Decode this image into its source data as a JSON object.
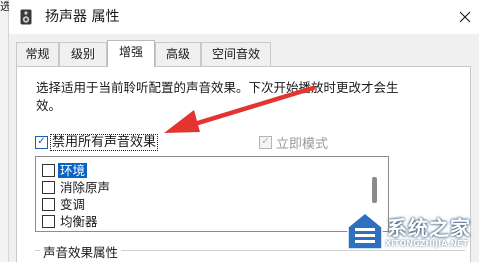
{
  "window": {
    "title": "扬声器 属性",
    "left_edge_text": "选"
  },
  "tabs": [
    {
      "label": "常规"
    },
    {
      "label": "级别"
    },
    {
      "label": "增强",
      "active": true
    },
    {
      "label": "高级"
    },
    {
      "label": "空间音效"
    }
  ],
  "enhancements": {
    "description_line1": "选择适用于当前聆听配置的声音效果。下次开始播放时更改才会生",
    "description_line2": "效。",
    "disable_all": {
      "label": "禁用所有声音效果",
      "checked": true
    },
    "immediate_mode": {
      "label": "立即模式",
      "checked": true,
      "enabled": false
    },
    "effects": [
      {
        "label": "环境",
        "checked": false,
        "selected": true
      },
      {
        "label": "消除原声",
        "checked": false
      },
      {
        "label": "变调",
        "checked": false
      },
      {
        "label": "均衡器",
        "checked": false
      }
    ],
    "properties_group_label": "声音效果属性"
  },
  "watermark": {
    "title": "系统之家",
    "subtitle": "XITONGZHIJIA.NET"
  },
  "colors": {
    "accent": "#0a64c8",
    "arrow": "#e3342f",
    "dialog_background": "#f0f0f0"
  }
}
